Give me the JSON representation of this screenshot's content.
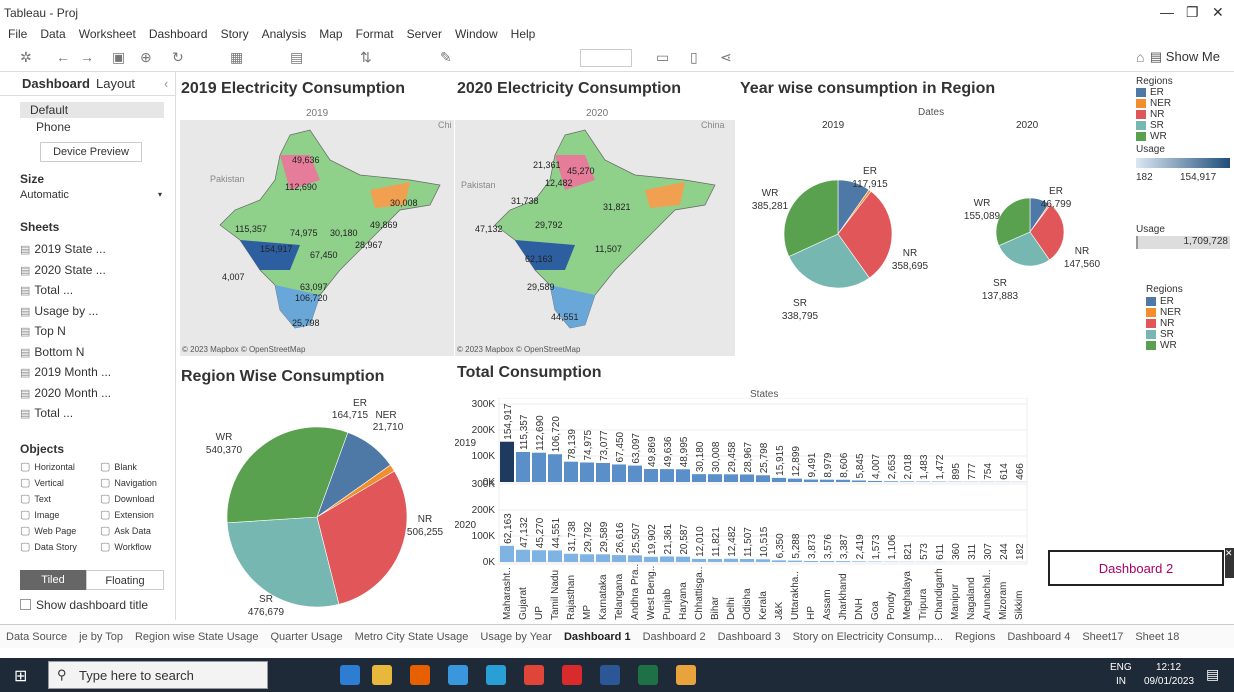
{
  "window": {
    "title": "Tableau - Proj",
    "minimize": "—",
    "maximize": "❐",
    "close": "✕"
  },
  "menu": [
    "File",
    "Data",
    "Worksheet",
    "Dashboard",
    "Story",
    "Analysis",
    "Map",
    "Format",
    "Server",
    "Window",
    "Help"
  ],
  "toolbar": {
    "show_me": "Show Me"
  },
  "left": {
    "tab_dashboard": "Dashboard",
    "tab_layout": "Layout",
    "devices": [
      "Default",
      "Phone"
    ],
    "device_preview": "Device Preview",
    "size_title": "Size",
    "size_value": "Automatic",
    "sheets_title": "Sheets",
    "sheets": [
      "2019 State ...",
      "2020 State ...",
      "Total ...",
      "Usage by ...",
      "Top N",
      "Bottom N",
      "2019 Month ...",
      "2020 Month ...",
      "Total ..."
    ],
    "objects_title": "Objects",
    "objects_left": [
      "Horizontal",
      "Vertical",
      "Text",
      "Image",
      "Web Page",
      "Data Story"
    ],
    "objects_right": [
      "Blank",
      "Navigation",
      "Download",
      "Extension",
      "Ask Data",
      "Workflow"
    ],
    "tiled": "Tiled",
    "floating": "Floating",
    "show_title": "Show dashboard title"
  },
  "charts": {
    "map2019": {
      "title": "2019 Electricity Consumption",
      "sub": "2019",
      "attr": "© 2023 Mapbox © OpenStreetMap",
      "labels": [
        "49,636",
        "112,690",
        "30,008",
        "115,357",
        "74,975",
        "30,180",
        "49,869",
        "154,917",
        "28,967",
        "67,450",
        "63,097",
        "106,720",
        "25,798",
        "4,007"
      ],
      "country1": "Pakistan",
      "country2": "Chi"
    },
    "map2020": {
      "title": "2020 Electricity Consumption",
      "sub": "2020",
      "attr": "© 2023 Mapbox © OpenStreetMap",
      "labels": [
        "21,361",
        "12,482",
        "45,270",
        "31,738",
        "31,821",
        "47,132",
        "29,792",
        "11,507",
        "62,163",
        "29,589",
        "44,551"
      ],
      "country1": "Pakistan",
      "country2": "China"
    },
    "yearwise": {
      "title": "Year wise consumption in Region",
      "dates": "Dates",
      "y2019": "2019",
      "y2020": "2020"
    },
    "regionwise": {
      "title": "Region Wise Consumption"
    },
    "total": {
      "title": "Total Consumption",
      "states_label": "States",
      "row2019": "2019",
      "row2020": "2020"
    }
  },
  "chart_data": [
    {
      "type": "pie",
      "title": "Year wise consumption in Region",
      "series": [
        {
          "name": "2019",
          "labels": [
            "ER",
            "NER",
            "NR",
            "SR",
            "WR"
          ],
          "values": [
            117915,
            9000,
            358695,
            338795,
            385281
          ],
          "label_text": [
            "ER\n117,915",
            "",
            "NR\n358,695",
            "SR\n338,795",
            "WR\n385,281"
          ]
        },
        {
          "name": "2020",
          "labels": [
            "ER",
            "NER",
            "NR",
            "SR",
            "WR"
          ],
          "values": [
            46799,
            3500,
            147560,
            137883,
            155089
          ],
          "label_text": [
            "ER\n46,799",
            "",
            "NR\n147,560",
            "SR\n137,883",
            "WR\n155,089"
          ]
        }
      ]
    },
    {
      "type": "pie",
      "title": "Region Wise Consumption",
      "labels": [
        "ER",
        "NER",
        "NR",
        "SR",
        "WR"
      ],
      "values": [
        164715,
        21710,
        506255,
        476679,
        540370
      ]
    },
    {
      "type": "bar",
      "title": "Total Consumption",
      "xlabel": "States",
      "categories": [
        "Maharasht..",
        "Gujarat",
        "UP",
        "Tamil Nadu",
        "Rajasthan",
        "MP",
        "Karnataka",
        "Telangana",
        "Andhra Pra..",
        "West Beng..",
        "Punjab",
        "Haryana",
        "Chhattisga..",
        "Bihar",
        "Delhi",
        "Odisha",
        "Kerala",
        "J&K",
        "Uttarakha..",
        "HP",
        "Assam",
        "Jharkhand",
        "DNH",
        "Goa",
        "Pondy",
        "Meghalaya",
        "Tripura",
        "Chandigarh",
        "Manipur",
        "Nagaland",
        "Arunachal..",
        "Mizoram",
        "Sikkim"
      ],
      "series": [
        {
          "name": "2019",
          "values": [
            154917,
            115357,
            112690,
            106720,
            78139,
            74975,
            73077,
            67450,
            63097,
            49869,
            49636,
            48995,
            30180,
            30008,
            29458,
            28967,
            25798,
            15915,
            12899,
            9491,
            8979,
            8606,
            5845,
            4007,
            2653,
            2018,
            1483,
            1472,
            895,
            777,
            754,
            614,
            466
          ]
        },
        {
          "name": "2020",
          "values": [
            62163,
            47132,
            45270,
            44551,
            31738,
            29792,
            29589,
            26616,
            25507,
            19902,
            21361,
            20587,
            12010,
            11821,
            12482,
            11507,
            10515,
            6350,
            5288,
            3873,
            3576,
            3387,
            2419,
            1573,
            1106,
            821,
            573,
            611,
            360,
            311,
            307,
            244,
            182
          ]
        }
      ],
      "ylim": [
        0,
        300000
      ],
      "yticks": [
        "300K",
        "200K",
        "100K",
        "0K"
      ]
    }
  ],
  "legend": {
    "regions_title": "Regions",
    "regions": [
      {
        "name": "ER",
        "color": "#4e79a7"
      },
      {
        "name": "NER",
        "color": "#f28e2b"
      },
      {
        "name": "NR",
        "color": "#e15759"
      },
      {
        "name": "SR",
        "color": "#76b7b2"
      },
      {
        "name": "WR",
        "color": "#59a14f"
      }
    ],
    "usage_title": "Usage",
    "usage_min": "182",
    "usage_max": "154,917",
    "usage2_title": "Usage",
    "usage2_value": "1,709,728",
    "regions2_title": "Regions"
  },
  "dashboard_thumb": "Dashboard 2",
  "sheet_tabs": [
    "Data Source",
    "je by Top",
    "Region wise State Usage",
    "Quarter Usage",
    "Metro City State Usage",
    "Usage by Year",
    "Dashboard 1",
    "Dashboard 2",
    "Dashboard 3",
    "Story on Electricity Consump...",
    "Regions",
    "Dashboard 4",
    "Sheet17",
    "Sheet 18"
  ],
  "taskbar": {
    "search": "Type here to search",
    "lang1": "ENG",
    "lang2": "IN",
    "time": "12:12",
    "date": "09/01/2023"
  }
}
